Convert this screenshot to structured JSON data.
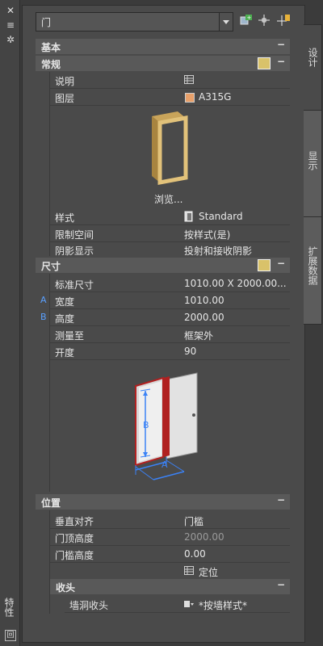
{
  "palette": {
    "combo": {
      "value": "门"
    },
    "toolbar": {
      "select_icon": "select-objects-icon",
      "add_icon": "add-selection-icon",
      "pick_icon": "quick-select-icon"
    },
    "tabs": [
      "设计",
      "显示",
      "扩展数据"
    ],
    "left_title": "特性",
    "sections": {
      "basic": "基本",
      "general": "常规",
      "dimensions": "尺寸",
      "location": "位置",
      "head": "收头"
    },
    "general_rows": [
      {
        "label": "说明",
        "value": ""
      },
      {
        "label": "图层",
        "value": "A315G",
        "swatch": "#e8a06a"
      }
    ],
    "preview_label": "浏览...",
    "general_rows2": [
      {
        "label": "样式",
        "value": "Standard"
      },
      {
        "label": "限制空间",
        "value": "按样式(是)"
      },
      {
        "label": "阴影显示",
        "value": "投射和接收阴影"
      }
    ],
    "dimension_rows": [
      {
        "label": "标准尺寸",
        "value": "1010.00  X  2000.00..."
      },
      {
        "letter": "A",
        "label": "宽度",
        "value": "1010.00"
      },
      {
        "letter": "B",
        "label": "高度",
        "value": "2000.00"
      },
      {
        "label": "测量至",
        "value": "框架外"
      },
      {
        "label": "开度",
        "value": "90"
      }
    ],
    "diagram_labels": {
      "a": "A",
      "b": "B"
    },
    "location_rows": [
      {
        "label": "垂直对齐",
        "value": "门槛"
      },
      {
        "label": "门顶高度",
        "value": "2000.00"
      },
      {
        "label": "门槛高度",
        "value": "0.00"
      },
      {
        "label": "",
        "value": "定位"
      }
    ],
    "head_rows": [
      {
        "label": "墙洞收头",
        "value": "*按墙样式*"
      }
    ]
  }
}
